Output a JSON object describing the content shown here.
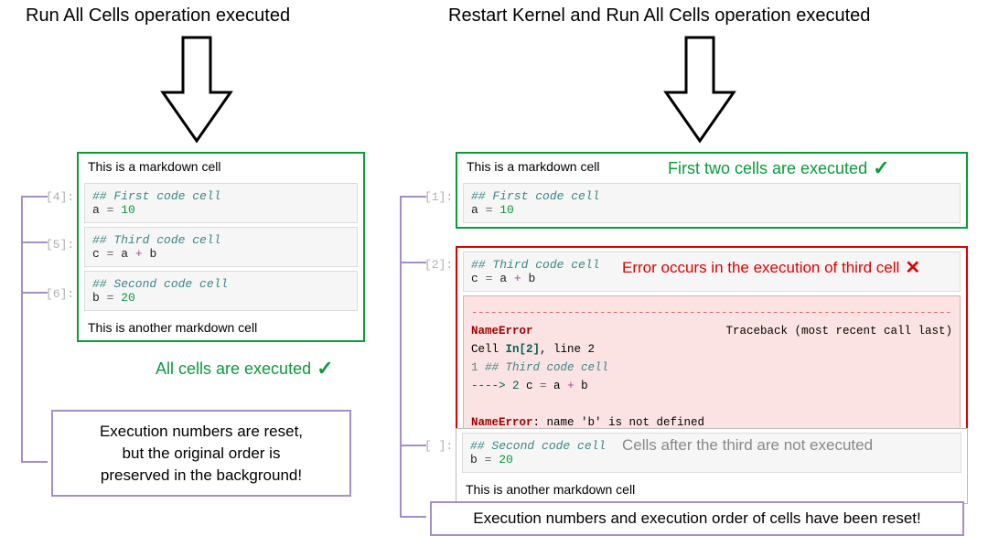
{
  "left": {
    "heading": "Run All Cells operation executed",
    "md1": "This is a markdown cell",
    "cell1": {
      "exec": "[4]:",
      "comment": "## First code cell",
      "line": {
        "var": "a",
        "eq": " = ",
        "num": "10"
      }
    },
    "cell2": {
      "exec": "[5]:",
      "comment": "## Third code cell",
      "line": {
        "var": "c",
        "eq": " = ",
        "expr_a": "a",
        "plus": " + ",
        "expr_b": "b"
      }
    },
    "cell3": {
      "exec": "[6]:",
      "comment": "## Second code cell",
      "line": {
        "var": "b",
        "eq": " = ",
        "num": "20"
      }
    },
    "md2": "This is another markdown cell",
    "success": "All cells are executed",
    "callout": "Execution numbers are reset,\nbut the original order is\npreserved in the background!"
  },
  "right": {
    "heading": "Restart Kernel and Run All Cells operation executed",
    "md1": "This is a markdown cell",
    "label_top": "First two cells are executed",
    "cell1": {
      "exec": "[1]:",
      "comment": "## First code cell",
      "line": {
        "var": "a",
        "eq": " = ",
        "num": "10"
      }
    },
    "cell2": {
      "exec": "[2]:",
      "comment": "## Third code cell",
      "line": {
        "var": "c",
        "eq": " = ",
        "expr_a": "a",
        "plus": " + ",
        "expr_b": "b"
      }
    },
    "label_err": "Error occurs in the execution of third cell",
    "error": {
      "name1": "NameError",
      "trace": "Traceback (most recent call last)",
      "cellref": "Cell ",
      "inref": "In[2]",
      "lineref": ", line 2",
      "line1_pre": "      1 ",
      "line1_body": "## Third code cell",
      "line2_pre": "----> 2 ",
      "line2_body_c": "c",
      "line2_body_eq": " = ",
      "line2_body_a": "a",
      "line2_body_plus": " + ",
      "line2_body_b": "b",
      "name2": "NameError",
      "msg": ": name 'b' is not defined"
    },
    "cell3": {
      "exec": "[ ]:",
      "comment": "## Second code cell",
      "line": {
        "var": "b",
        "eq": " = ",
        "num": "20"
      }
    },
    "label_bottom": "Cells after the third are not executed",
    "md2": "This is another markdown cell",
    "callout": "Execution numbers and execution order of cells have been reset!"
  }
}
